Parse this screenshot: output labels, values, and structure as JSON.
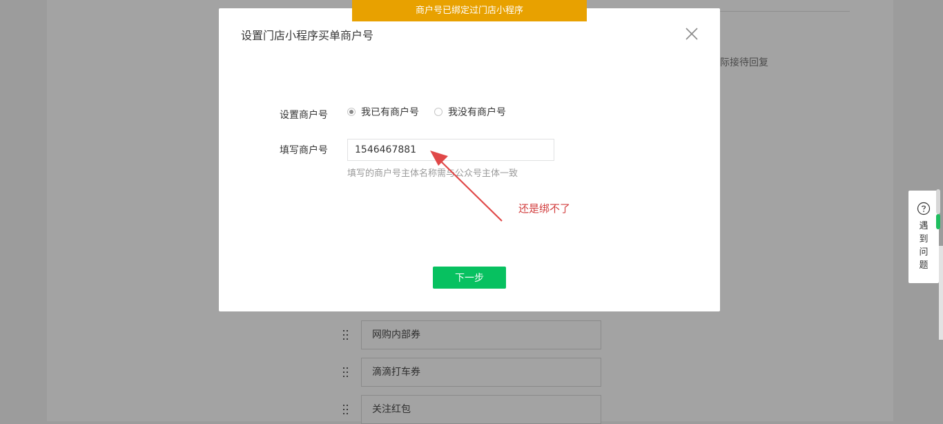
{
  "toast": {
    "text": "商户号已绑定过门店小程序",
    "color": "#e8a100"
  },
  "background": {
    "snippet": "际接待回复",
    "list_items": [
      "网购内部券",
      "滴滴打车券",
      "关注红包"
    ]
  },
  "modal": {
    "title": "设置门店小程序买单商户号",
    "close_icon": "close-icon",
    "merchant_setting": {
      "label": "设置商户号",
      "options": [
        {
          "label": "我已有商户号",
          "checked": true
        },
        {
          "label": "我没有商户号",
          "checked": false
        }
      ]
    },
    "merchant_input": {
      "label": "填写商户号",
      "value": "1546467881",
      "hint": "填写的商户号主体名称需与公众号主体一致"
    },
    "annotation": {
      "text": "还是绑不了",
      "color": "#d23c3c"
    },
    "next_button": {
      "label": "下一步",
      "color": "#07c160"
    }
  },
  "help_widget": {
    "icon": "question-circle-icon",
    "label": "遇到问题"
  }
}
